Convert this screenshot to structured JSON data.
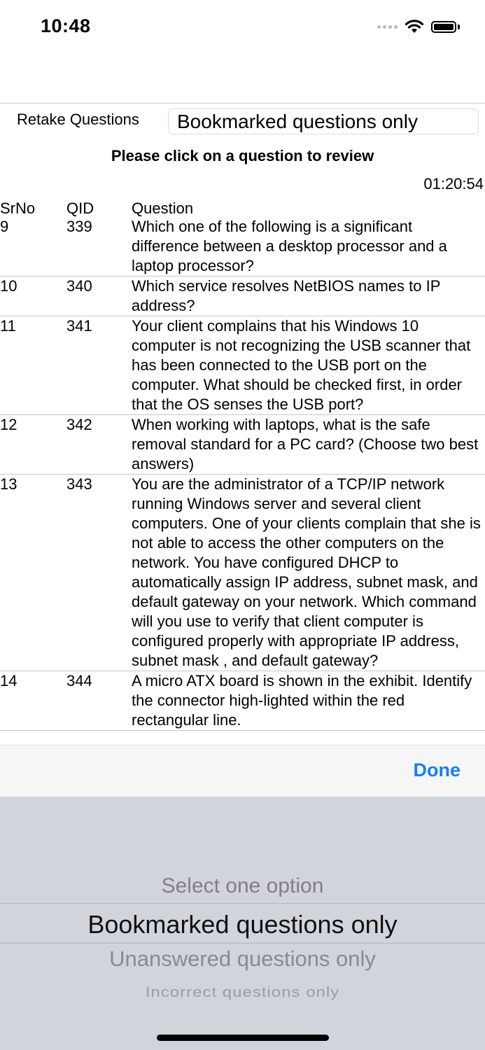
{
  "status_bar": {
    "time": "10:48"
  },
  "filter": {
    "label": "Retake Questions",
    "selected": "Bookmarked questions only"
  },
  "instruction": "Please click on a question to review",
  "timer": "01:20:54",
  "table": {
    "headers": {
      "srno": "SrNo",
      "qid": "QID",
      "question": "Question"
    },
    "rows": [
      {
        "srno": "9",
        "qid": "339",
        "question": "Which one of the following is a significant difference between a desktop processor and a laptop processor?"
      },
      {
        "srno": "10",
        "qid": "340",
        "question": "Which service resolves NetBIOS names to IP address?"
      },
      {
        "srno": "11",
        "qid": "341",
        "question": "Your client complains that his Windows 10 computer is not recognizing the USB scanner that has been connected to the USB port on the computer. What should be checked first, in order that the OS senses the USB port?"
      },
      {
        "srno": "12",
        "qid": "342",
        "question": "When working with laptops, what is the safe removal standard for a PC card? (Choose two best answers)"
      },
      {
        "srno": "13",
        "qid": "343",
        "question": "You are the administrator of a TCP/IP network running Windows server and several client computers. One of your clients complain that she is not able to access the other computers on the network. You have configured DHCP to automatically assign IP address, subnet mask, and default gateway on your network. Which command will you use to verify that client computer is configured properly with appropriate IP address, subnet mask , and default gateway?"
      },
      {
        "srno": "14",
        "qid": "344",
        "question": "A micro ATX board is shown in the exhibit. Identify the connector high-lighted within the red rectangular line."
      }
    ]
  },
  "toolbar": {
    "done_label": "Done"
  },
  "picker": {
    "options": [
      "Select one option",
      "Bookmarked questions only",
      "Unanswered questions only",
      "Incorrect questions only"
    ],
    "selected_index": 1
  }
}
